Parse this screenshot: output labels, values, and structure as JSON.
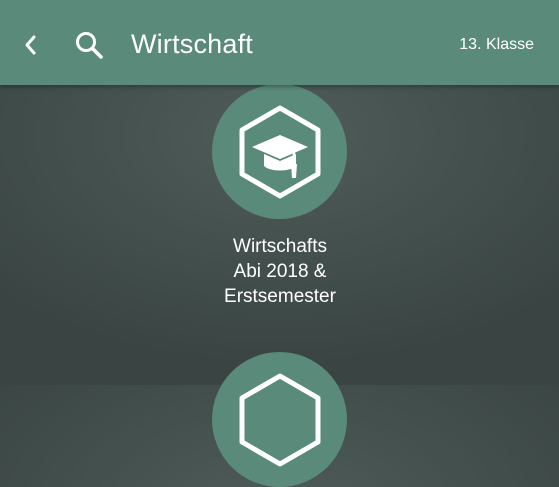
{
  "header": {
    "back_icon": "chevron-left-icon",
    "search_icon": "search-icon",
    "title": "Wirtschaft",
    "grade": "13. Klasse"
  },
  "categories": [
    {
      "icon": "graduation-cap-hexagon-icon",
      "label_lines": [
        "Wirtschafts",
        "Abi 2018 &",
        "Erstsemester"
      ]
    },
    {
      "icon": "hexagon-icon"
    }
  ],
  "colors": {
    "accent": "#5a8a7a",
    "background": "#434f4d",
    "text": "#ffffff"
  }
}
